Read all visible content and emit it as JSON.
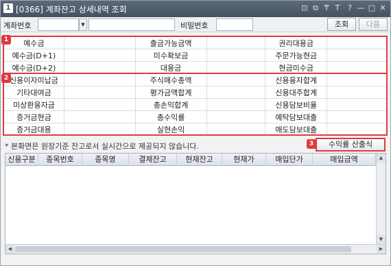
{
  "window": {
    "icon_label": "1",
    "title": "[0366] 계좌잔고 상세내역 조회",
    "title_buttons": [
      "⊡",
      "⧉",
      "₸",
      "T",
      "?",
      "—",
      "□",
      "✕"
    ]
  },
  "search": {
    "account_label": "계좌번호",
    "account_value": "",
    "account_name_value": "",
    "password_label": "비밀번호",
    "password_value": "",
    "query_button": "조회",
    "next_button": "다음"
  },
  "info_grid": {
    "rows": [
      [
        "예수금",
        "",
        "출금가능금액",
        "",
        "권리대용금",
        ""
      ],
      [
        "예수금(D+1)",
        "",
        "미수확보금",
        "",
        "주문가능현금",
        ""
      ],
      [
        "예수금(D+2)",
        "",
        "대용금",
        "",
        "현금미수금",
        ""
      ],
      [
        "신용이자미납금",
        "",
        "주식매수총액",
        "",
        "신용융자합계",
        ""
      ],
      [
        "기타대여금",
        "",
        "평가금액합계",
        "",
        "신용대주합계",
        ""
      ],
      [
        "미상환융자금",
        "",
        "총손익합계",
        "",
        "신용담보비율",
        ""
      ],
      [
        "증거금현금",
        "",
        "총수익률",
        "",
        "예탁담보대출",
        ""
      ],
      [
        "증거금대용",
        "",
        "실현손익",
        "",
        "매도담보대출",
        ""
      ]
    ]
  },
  "annotations": {
    "badge1": "1",
    "badge2": "2",
    "badge3": "3",
    "accent": "#e03a3e"
  },
  "note": "* 본화면은 원장기준 잔고로서 실시간으로 제공되지 않습니다.",
  "calc_button": "수익률 산출식",
  "holdings": {
    "columns": [
      "신용구분",
      "종목번호",
      "종목명",
      "결제잔고",
      "현재잔고",
      "현재가",
      "매입단가",
      "매입금액"
    ]
  }
}
